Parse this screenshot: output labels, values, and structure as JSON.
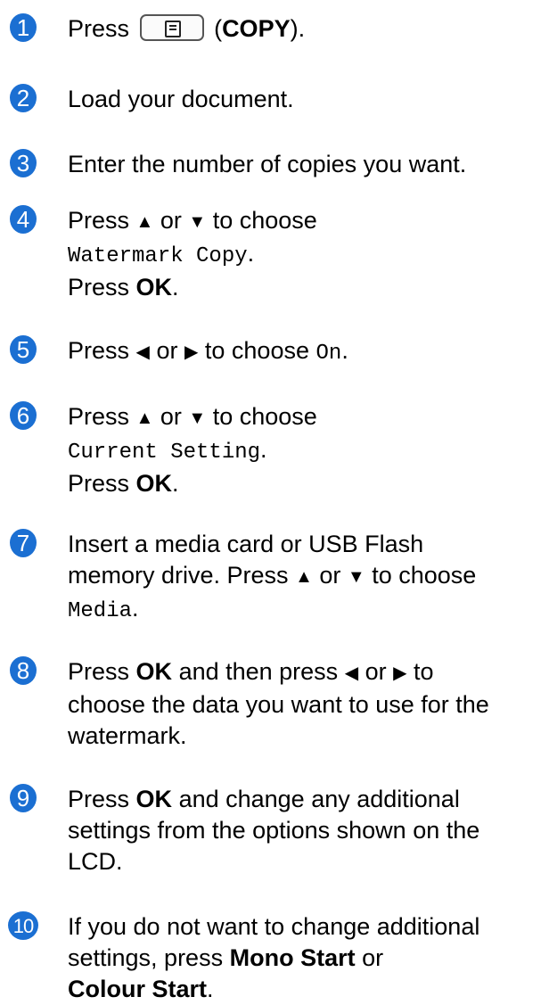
{
  "accent_color": "#1b6fd2",
  "steps": [
    {
      "num": "1",
      "t0": "Press",
      "key_icon": "copy-key-icon",
      "t1": "(",
      "b1": "COPY",
      "t2": ")."
    },
    {
      "num": "2",
      "t0": "Load your document."
    },
    {
      "num": "3",
      "t0": "Enter the number of copies you want."
    },
    {
      "num": "4",
      "t0": "Press",
      "up": "▲",
      "t1": "or",
      "down": "▼",
      "t2": "to choose",
      "m1": "Watermark Copy",
      "t3": ".",
      "t4": "Press",
      "b1": "OK",
      "t5": "."
    },
    {
      "num": "5",
      "t0": "Press",
      "left": "◀",
      "t1": "or",
      "right": "▶",
      "t2": "to choose",
      "m1": "On",
      "t3": "."
    },
    {
      "num": "6",
      "t0": "Press",
      "up": "▲",
      "t1": "or",
      "down": "▼",
      "t2": "to choose",
      "m1": "Current Setting",
      "t3": ".",
      "t4": "Press",
      "b1": "OK",
      "t5": "."
    },
    {
      "num": "7",
      "l1": "Insert a media card or USB Flash",
      "l2": "memory drive. Press",
      "up": "▲",
      "t1": "or",
      "down": "▼",
      "t2": "to choose",
      "m1": "Media",
      "t3": "."
    },
    {
      "num": "8",
      "t0": "Press",
      "b1": "OK",
      "t1": "and then press",
      "left": "◀",
      "t2": "or",
      "right": "▶",
      "t3": "to",
      "l2": "choose the data you want to use for the",
      "l3": "watermark."
    },
    {
      "num": "9",
      "t0": "Press",
      "b1": "OK",
      "t1": "and change any additional",
      "l2": "settings from the options shown on the",
      "l3": "LCD."
    },
    {
      "num": "10",
      "l1": "If you do not want to change additional",
      "t0": "settings, press",
      "b1": "Mono Start",
      "t1": "or",
      "b2": "Colour Start",
      "t2": "."
    }
  ]
}
